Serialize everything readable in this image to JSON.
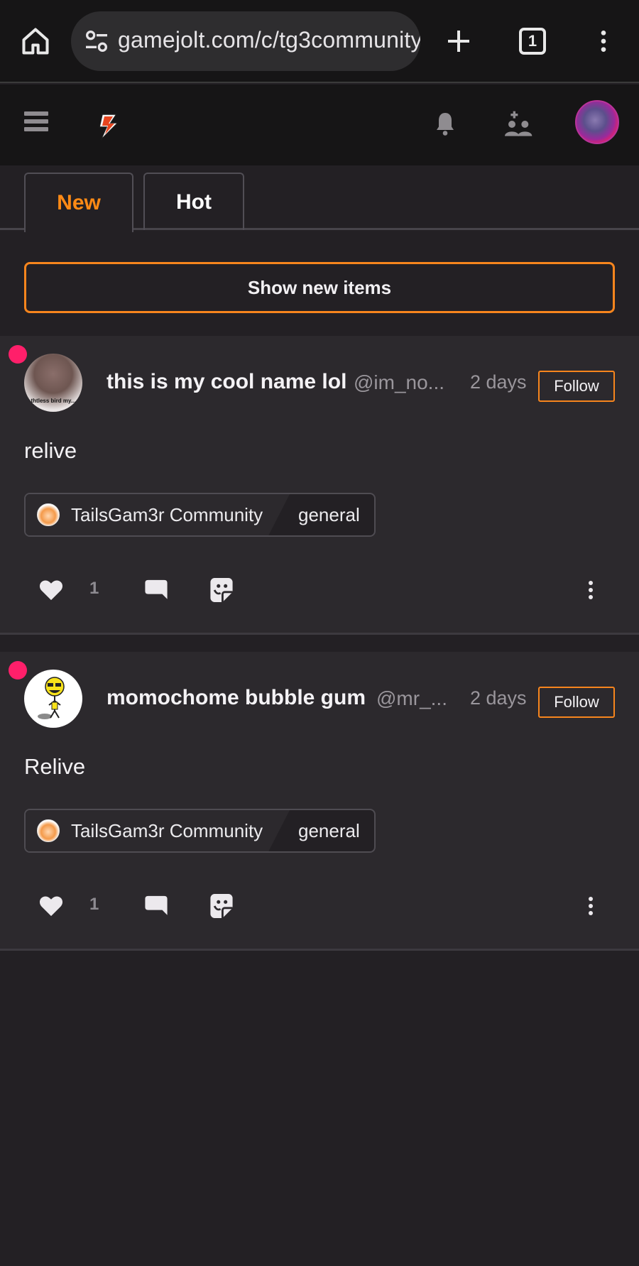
{
  "browser": {
    "url": "gamejolt.com/c/tg3community",
    "tab_count": "1"
  },
  "header": {
    "brand": "Game Jolt"
  },
  "feed_tabs": [
    {
      "label": "New",
      "active": true
    },
    {
      "label": "Hot",
      "active": false
    }
  ],
  "show_new_label": "Show new items",
  "posts": [
    {
      "display_name": "this is my cool name lol",
      "handle": "@im_no...",
      "time": "2 days",
      "follow_label": "Follow",
      "body": "relive",
      "community": "TailsGam3r Community",
      "channel": "general",
      "likes": "1",
      "avatar_caption": "thtless bird my..."
    },
    {
      "display_name": "momochome bubble gum",
      "handle": "@mr_...",
      "time": "2 days",
      "follow_label": "Follow",
      "body": "Relive",
      "community": "TailsGam3r Community",
      "channel": "general",
      "likes": "1"
    }
  ],
  "colors": {
    "accent": "#f7851d",
    "unread": "#ff1f6a",
    "background": "#232024",
    "card": "#2c292d"
  }
}
